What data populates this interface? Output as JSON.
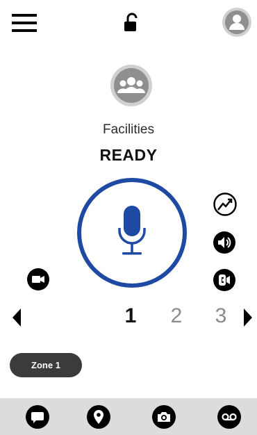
{
  "channel": {
    "name": "Facilities",
    "status": "READY"
  },
  "channels": {
    "items": [
      "1",
      "2",
      "3"
    ],
    "active": "1"
  },
  "zone": {
    "label": "Zone 1"
  },
  "colors": {
    "accent": "#1e4aa3",
    "icon": "#000000",
    "bottom_bar": "#dcdcdc",
    "avatar_gray": "#8f8f8f"
  },
  "icons": {
    "top": [
      "menu-icon",
      "unlocked-icon",
      "profile-avatar-icon"
    ],
    "side": [
      "signal-icon",
      "speaker-icon",
      "call-icon",
      "video-icon"
    ],
    "bottom": [
      "message-icon",
      "location-icon",
      "camera-icon",
      "voicemail-icon"
    ]
  }
}
